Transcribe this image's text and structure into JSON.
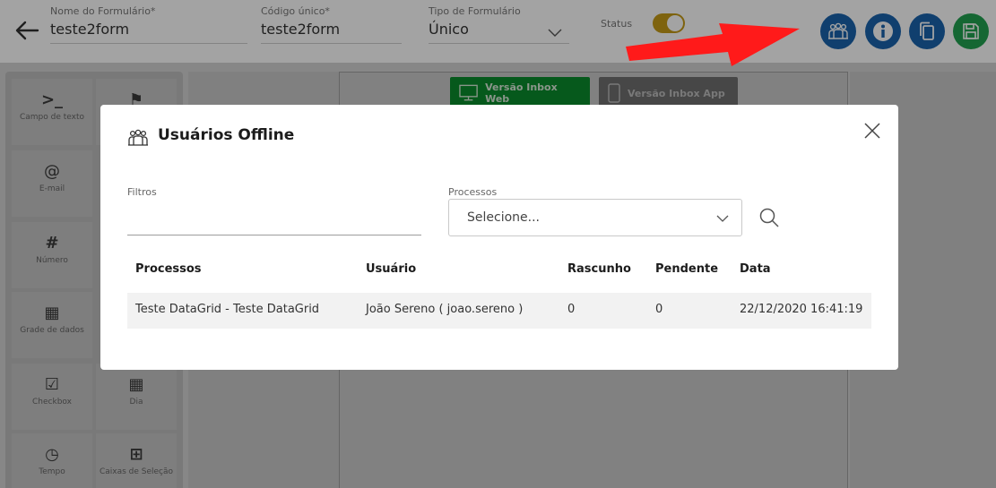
{
  "header": {
    "fields": [
      {
        "label": "Nome do Formulário*",
        "value": "teste2form"
      },
      {
        "label": "Código único*",
        "value": "teste2form"
      },
      {
        "label": "Tipo de Formulário",
        "value": "Único"
      }
    ],
    "status_label": "Status",
    "status_on": true,
    "action_icons": [
      "users-icon",
      "info-icon",
      "copy-icon",
      "save-icon"
    ],
    "colors": {
      "action_blue": "#1a63ad",
      "save_green": "#21a250",
      "toggle": "#c69b16",
      "annotation_arrow": "#ff1a1a"
    }
  },
  "sidebar": {
    "tools": [
      {
        "icon": "terminal-icon",
        "label": "Campo de texto"
      },
      {
        "icon": "spy-icon",
        "label": ""
      },
      {
        "icon": "at-icon",
        "label": "E-mail"
      },
      {
        "icon": "hash-icon",
        "label": "Número"
      },
      {
        "icon": "grid-icon",
        "label": "Grade de dados"
      },
      {
        "icon": "checkbox-icon",
        "label": "Checkbox"
      },
      {
        "icon": "calendar-icon",
        "label": "Dia"
      },
      {
        "icon": "clock-icon",
        "label": "Tempo"
      },
      {
        "icon": "plus-box-icon",
        "label": "Caixas de Seleção"
      }
    ]
  },
  "canvas": {
    "web_button": "Versão Inbox Web",
    "app_button": "Versão Inbox App"
  },
  "modal": {
    "title": "Usuários Offline",
    "filtros_label": "Filtros",
    "filtros_value": "",
    "processos_label": "Processos",
    "processos_value": "Selecione...",
    "table": {
      "headers": [
        "Processos",
        "Usuário",
        "Rascunho",
        "Pendente",
        "Data"
      ],
      "rows": [
        [
          "Teste DataGrid - Teste DataGrid",
          "João Sereno ( joao.sereno )",
          "0",
          "0",
          "22/12/2020 16:41:19"
        ]
      ]
    }
  }
}
